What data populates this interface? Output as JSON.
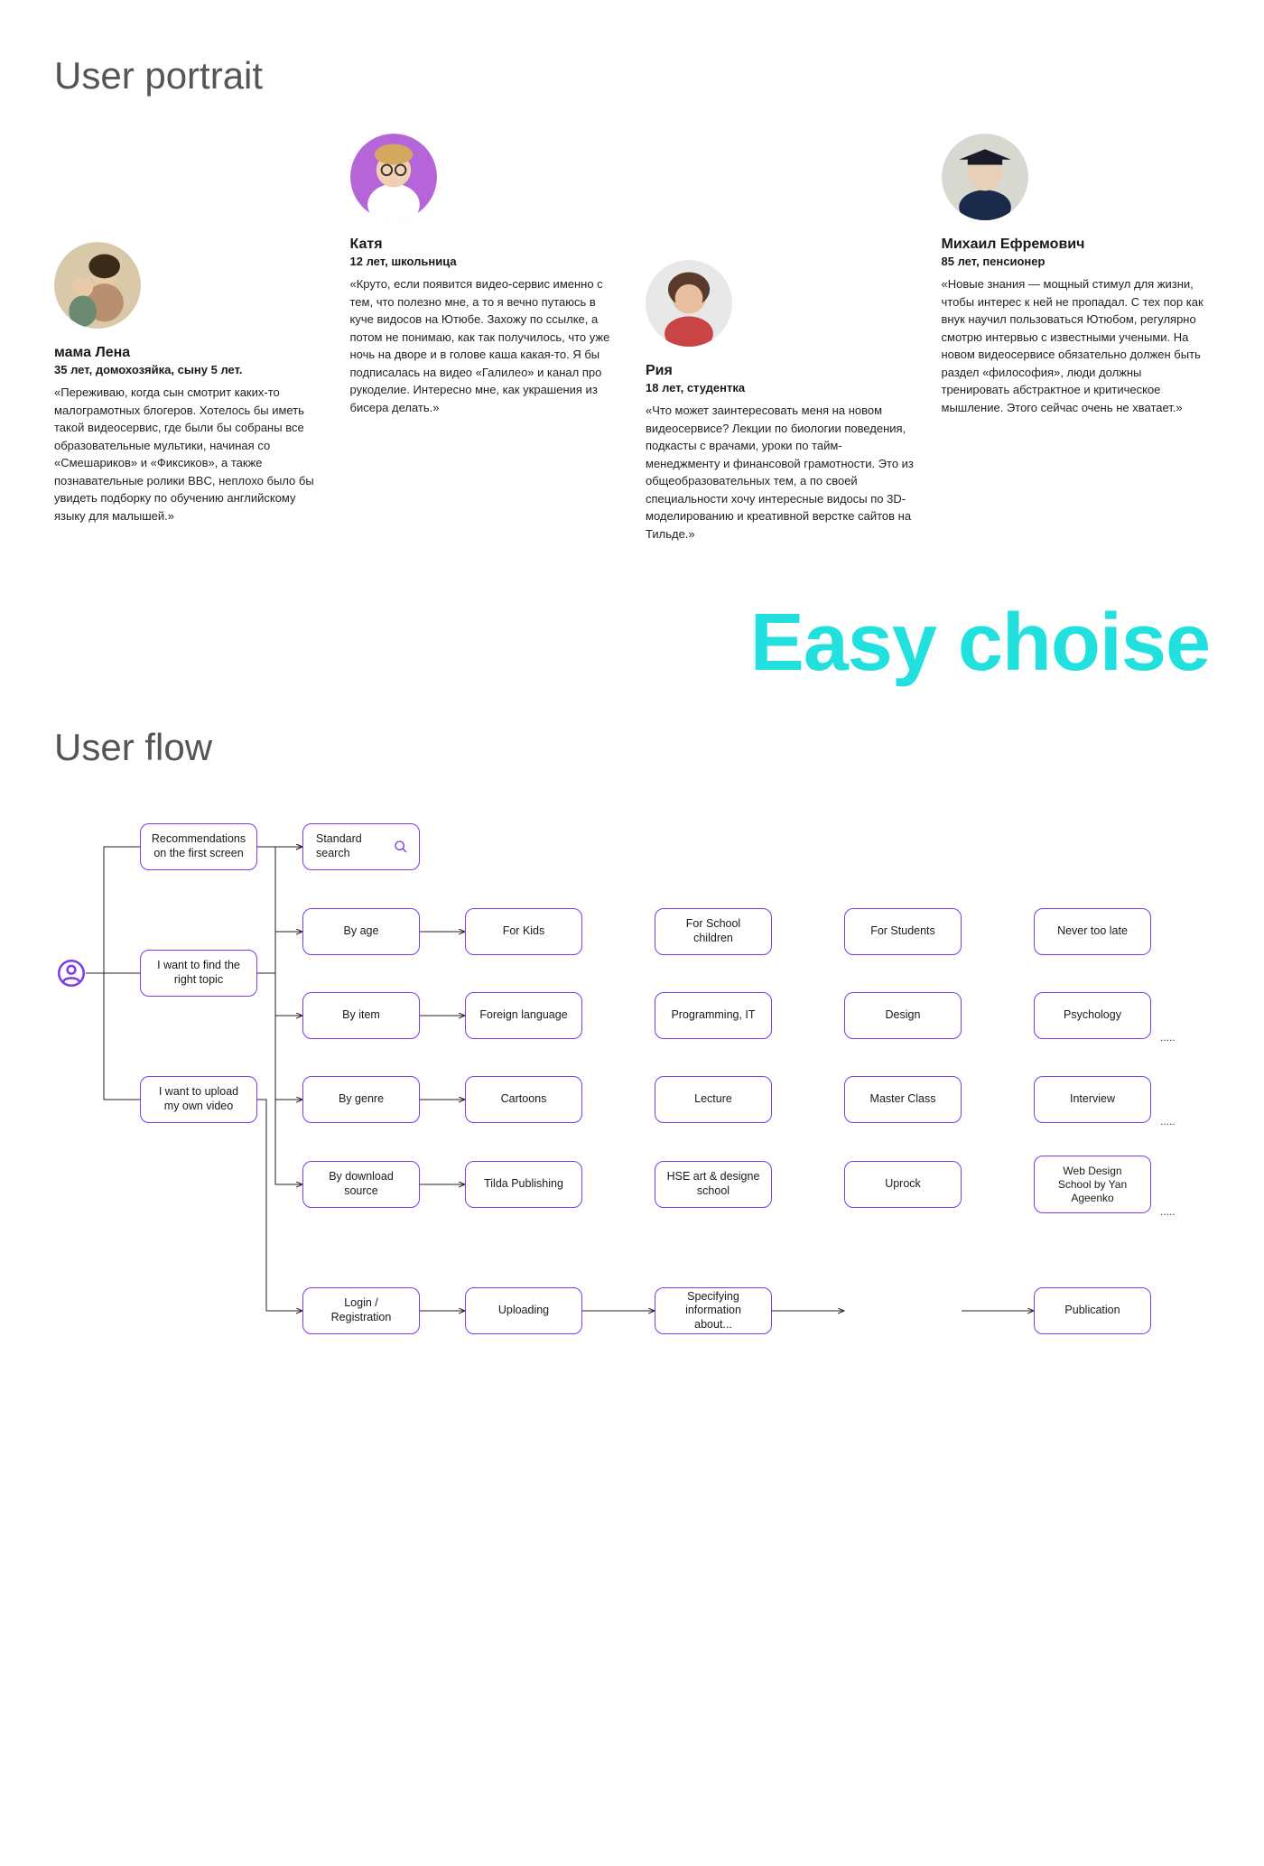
{
  "section_portrait_title": "User portrait",
  "section_flow_title": "User flow",
  "big_tag": "Easy choise",
  "personas": [
    {
      "name": "мама Лена",
      "meta": "35 лет, домохозяйка, сыну 5 лет.",
      "quote": "«Переживаю, когда сын смотрит каких-то малограмотных блогеров. Хотелось бы иметь такой видеосервис, где были бы собраны все образовательные мультики, начиная со «Смешариков» и «Фиксиков», а также познавательные ролики BBC, неплохо было бы увидеть подборку по обучению английскому языку для малышей.»"
    },
    {
      "name": "Катя",
      "meta": "12 лет, школьница",
      "quote": "«Круто, если появится видео-сервис именно с тем, что полезно мне, а то я вечно путаюсь в куче видосов на Ютюбе. Захожу по ссылке, а потом не понимаю, как так получилось, что уже ночь на дворе и в голове каша какая-то. Я бы подписалась на видео «Галилео» и канал про рукоделие. Интересно мне, как украшения из бисера делать.»"
    },
    {
      "name": "Рия",
      "meta": "18 лет, студентка",
      "quote": "«Что может заинтересовать меня на новом видеосервисе? Лекции по биологии поведения, подкасты с врачами, уроки по тайм-менеджменту и финансовой грамотности. Это из общеобразовательных тем, а по своей специальности хочу интересные видосы по 3D-моделированию и креативной верстке сайтов на Тильде.»"
    },
    {
      "name": "Михаил Ефремович",
      "meta": "85 лет, пенсионер",
      "quote": "«Новые знания — мощный стимул для жизни, чтобы интерес к ней не пропадал. С тех пор как внук научил пользоваться Ютюбом, регулярно смотрю интервью с известными учеными. На новом видеосервисе обязательно должен быть раздел «философия», люди должны тренировать абстрактное и критическое мышление. Этого сейчас очень не хватает.»"
    }
  ],
  "flow": {
    "user_icon": "user-icon",
    "level1": {
      "recommendations": "Recommendations on the first screen",
      "find_topic": "I want to find the right topic",
      "upload": "I want to upload my own video"
    },
    "search": {
      "standard": "Standard search",
      "by_age": "By age",
      "by_item": "By item",
      "by_genre": "By genre",
      "by_source": "By download source"
    },
    "age_items": [
      "For Kids",
      "For School children",
      "For Students",
      "Never too late"
    ],
    "item_items": [
      "Foreign language",
      "Programming, IT",
      "Design",
      "Psychology"
    ],
    "genre_items": [
      "Cartoons",
      "Lecture",
      "Master Class",
      "Interview"
    ],
    "source_items": [
      "Tilda Publishing",
      "HSE art & designe school",
      "Uprock",
      "Web Design School by Yan Ageenko"
    ],
    "upload_flow": [
      "Login / Registration",
      "Uploading",
      "Specifying information about...",
      "Publication"
    ],
    "dots": "....."
  }
}
